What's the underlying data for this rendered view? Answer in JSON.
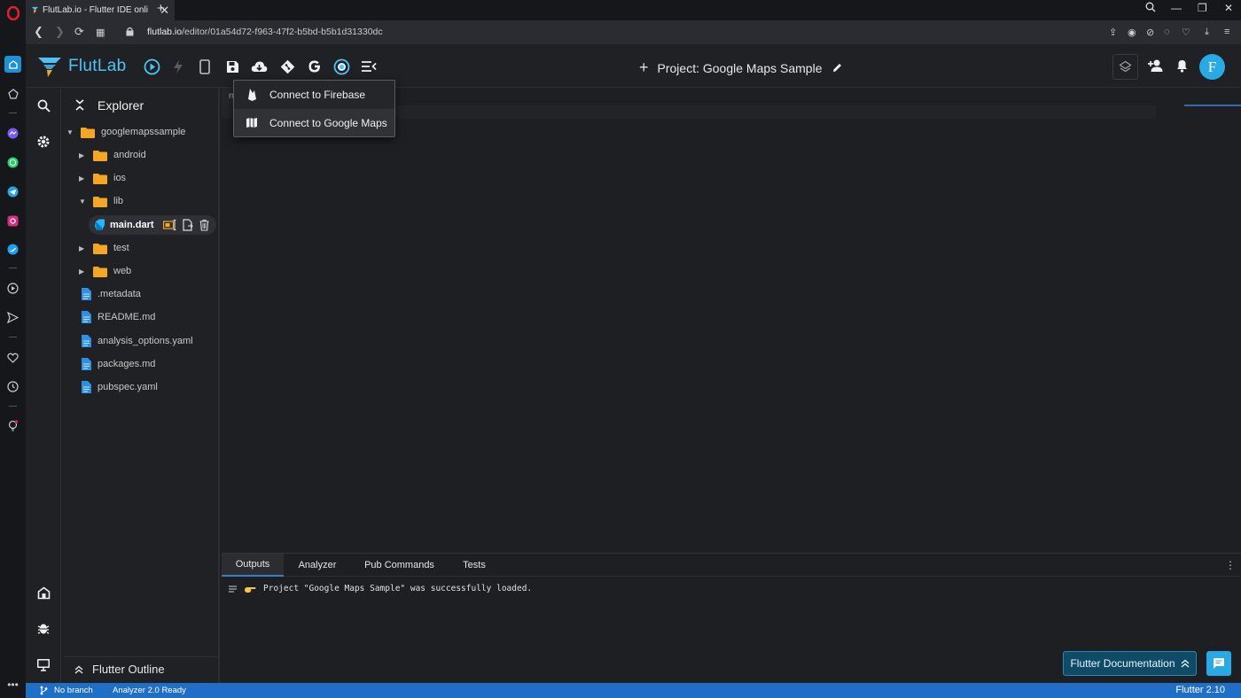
{
  "browser": {
    "tab_title": "FlutLab.io - Flutter IDE onli",
    "tab_close": "✕",
    "new_tab": "+",
    "url_domain": "flutlab.io",
    "url_path": "/editor/01a54d72-f963-47f2-b5bd-b5b1d31330dc",
    "window_controls": [
      "—",
      "❐",
      "✕"
    ]
  },
  "app": {
    "logo_text": "FlutLab",
    "project_title": "Project: Google Maps Sample",
    "avatar_letter": "F",
    "brand_color": "#4fc3f7",
    "accent_color": "#29a9e6"
  },
  "toolbar_icons": [
    "run-icon",
    "hot-reload-icon",
    "device-icon",
    "save-icon",
    "cloud-download-icon",
    "git-icon",
    "google-icon",
    "firebase-target-icon",
    "menu-collapse-icon"
  ],
  "menu": {
    "items": [
      {
        "label": "Connect to Firebase",
        "icon": "firebase-icon"
      },
      {
        "label": "Connect to Google Maps",
        "icon": "map-icon"
      }
    ]
  },
  "explorer": {
    "title": "Explorer",
    "root": "googlemapssample",
    "folders": [
      "android",
      "ios",
      "lib",
      "test",
      "web"
    ],
    "active_file": "main.dart",
    "files": [
      ".metadata",
      "README.md",
      "analysis_options.yaml",
      "packages.md",
      "pubspec.yaml"
    ],
    "outline_label": "Flutter Outline"
  },
  "editor": {
    "tab_label": "m"
  },
  "bottom_panel": {
    "tabs": [
      "Outputs",
      "Analyzer",
      "Pub Commands",
      "Tests"
    ],
    "active_tab": "Outputs",
    "log": "Project \"Google Maps Sample\" was successfully loaded.",
    "docs_button": "Flutter Documentation"
  },
  "status": {
    "branch": "No branch",
    "analyzer": "Analyzer 2.0 Ready",
    "version": "Flutter 2.10"
  }
}
